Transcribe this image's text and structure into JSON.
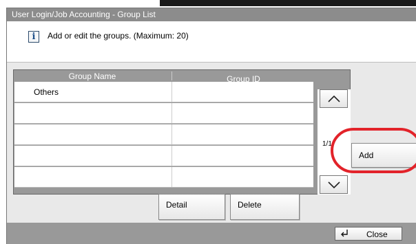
{
  "window": {
    "title": "User Login/Job Accounting - Group List"
  },
  "info": {
    "icon": "info-icon",
    "text": "Add or edit the groups. (Maximum: 20)"
  },
  "table": {
    "columns": [
      "Group Name",
      "Group ID"
    ],
    "rows": [
      {
        "name": "Others",
        "id": ""
      },
      {
        "name": "",
        "id": ""
      },
      {
        "name": "",
        "id": ""
      },
      {
        "name": "",
        "id": ""
      },
      {
        "name": "",
        "id": ""
      }
    ]
  },
  "pager": {
    "indicator": "1/1"
  },
  "buttons": {
    "add": "Add",
    "detail": "Detail",
    "delete": "Delete",
    "close": "Close"
  },
  "colors": {
    "title_bar": "#8c8c8c",
    "highlight": "#e2232a",
    "bottom_bar": "#999999"
  }
}
